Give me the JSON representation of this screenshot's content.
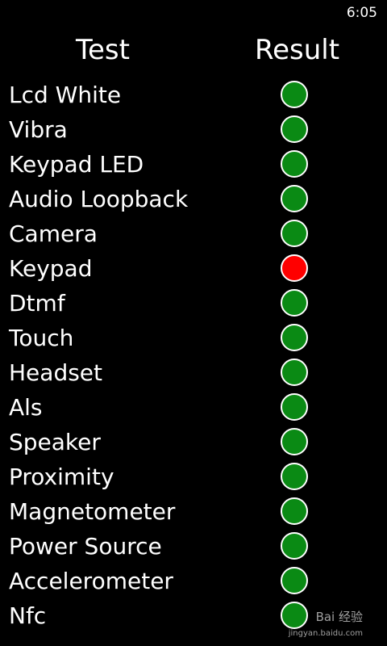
{
  "status_bar": {
    "time": "6:05"
  },
  "header": {
    "test_label": "Test",
    "result_label": "Result"
  },
  "colors": {
    "pass": "#0a8a14",
    "fail": "#ff0000"
  },
  "tests": [
    {
      "name": "Lcd White",
      "result": "pass"
    },
    {
      "name": "Vibra",
      "result": "pass"
    },
    {
      "name": "Keypad LED",
      "result": "pass"
    },
    {
      "name": "Audio Loopback",
      "result": "pass"
    },
    {
      "name": "Camera",
      "result": "pass"
    },
    {
      "name": "Keypad",
      "result": "fail"
    },
    {
      "name": "Dtmf",
      "result": "pass"
    },
    {
      "name": "Touch",
      "result": "pass"
    },
    {
      "name": "Headset",
      "result": "pass"
    },
    {
      "name": "Als",
      "result": "pass"
    },
    {
      "name": "Speaker",
      "result": "pass"
    },
    {
      "name": "Proximity",
      "result": "pass"
    },
    {
      "name": "Magnetometer",
      "result": "pass"
    },
    {
      "name": "Power Source",
      "result": "pass"
    },
    {
      "name": "Accelerometer",
      "result": "pass"
    },
    {
      "name": "Nfc",
      "result": "pass"
    }
  ],
  "watermark": {
    "text": "Bai 经验",
    "url": "jingyan.baidu.com"
  }
}
